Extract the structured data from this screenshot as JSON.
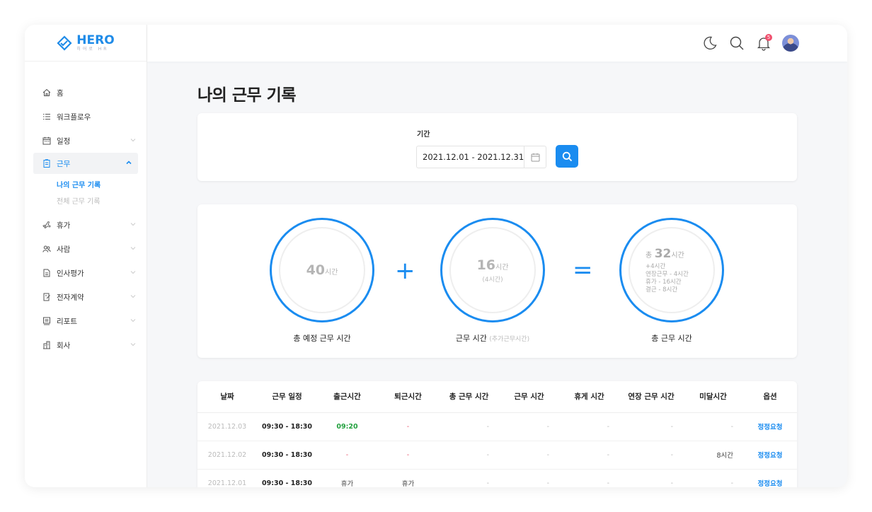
{
  "logo": {
    "title": "HERO",
    "subtitle": "히어로 HR"
  },
  "sidebar": {
    "items": [
      {
        "label": "홈"
      },
      {
        "label": "워크플로우"
      },
      {
        "label": "일정"
      },
      {
        "label": "근무"
      },
      {
        "label": "휴가"
      },
      {
        "label": "사람"
      },
      {
        "label": "인사평가"
      },
      {
        "label": "전자계약"
      },
      {
        "label": "리포트"
      },
      {
        "label": "회사"
      }
    ],
    "sub_items": [
      {
        "label": "나의 근무 기록"
      },
      {
        "label": "전체 근무 기록"
      }
    ]
  },
  "topbar": {
    "notification_count": "5"
  },
  "page": {
    "title": "나의 근무 기록"
  },
  "filter": {
    "label": "기간",
    "date_range": "2021.12.01 - 2021.12.31"
  },
  "summary": {
    "planned": {
      "value": "40",
      "unit": "시간",
      "caption": "총 예정 근무 시간"
    },
    "plus": "+",
    "worked": {
      "value": "16",
      "unit": "시간",
      "note": "(4시간)",
      "caption": "근무 시간",
      "caption_note": "(추가근무시간)"
    },
    "equals": "=",
    "total": {
      "prefix": "총",
      "value": "32",
      "unit": "시간",
      "lines": [
        "+4시간",
        "연장근무 - 4시간",
        "휴가 - 16시간",
        "결근 - 8시간"
      ],
      "caption": "총 근무 시간"
    }
  },
  "table": {
    "headers": [
      "날짜",
      "근무 일정",
      "출근시간",
      "퇴근시간",
      "총 근무 시간",
      "근무 시간",
      "휴게 시간",
      "연장 근무 시간",
      "미달시간",
      "옵션"
    ],
    "rows": [
      [
        "2021.12.03",
        "09:30 - 18:30",
        "09:20",
        "-",
        "-",
        "-",
        "-",
        "-",
        "-",
        "정정요청"
      ],
      [
        "2021.12.02",
        "09:30 - 18:30",
        "-",
        "-",
        "-",
        "-",
        "-",
        "-",
        "8시간",
        "정정요청"
      ],
      [
        "2021.12.01",
        "09:30 - 18:30",
        "휴가",
        "휴가",
        "-",
        "-",
        "-",
        "-",
        "-",
        "정정요청"
      ]
    ]
  },
  "colors": {
    "accent": "#1a8cf0",
    "green": "#23a13f",
    "red": "#e8566e"
  }
}
